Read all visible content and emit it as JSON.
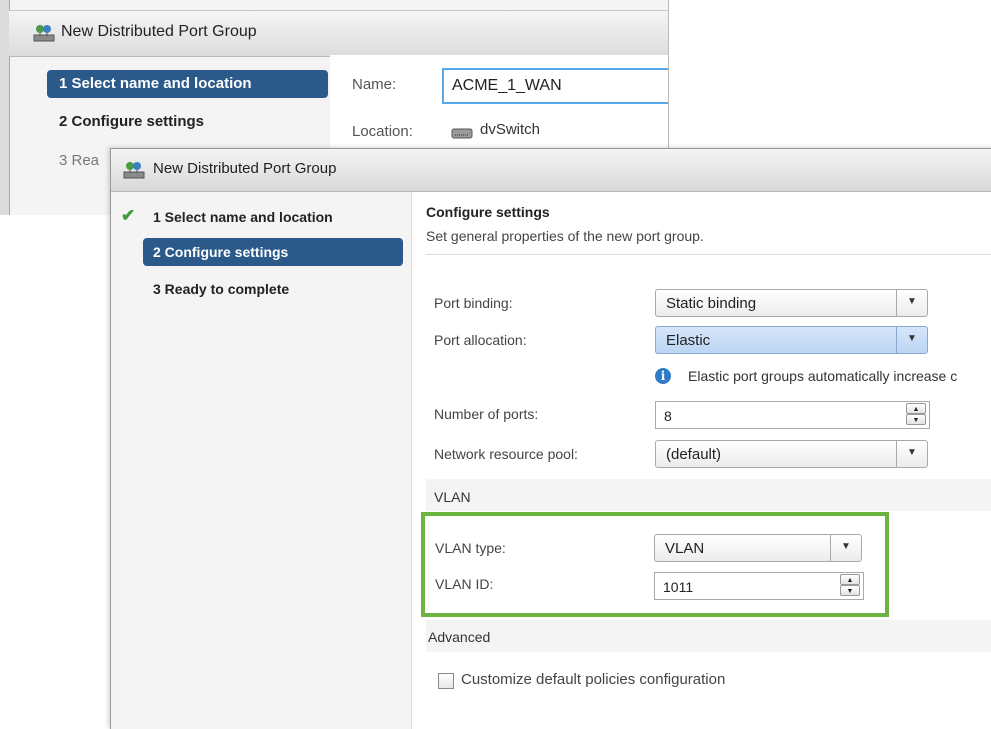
{
  "back_dialog": {
    "title": "New Distributed Port Group",
    "steps": [
      {
        "label": "1  Select name and location"
      },
      {
        "label": "2  Configure settings"
      },
      {
        "label": "3  Rea"
      }
    ],
    "name_label": "Name:",
    "name_value": "ACME_1_WAN",
    "location_label": "Location:",
    "location_value": "dvSwitch",
    "location_icon": "switch-icon"
  },
  "front_dialog": {
    "title": "New Distributed Port Group",
    "steps": [
      {
        "label": "1  Select name and location",
        "state": "completed"
      },
      {
        "label": "2  Configure settings",
        "state": "active"
      },
      {
        "label": "3  Ready to complete",
        "state": "pending"
      }
    ],
    "header": {
      "title": "Configure settings",
      "subtitle": "Set general properties of the new port group."
    },
    "fields": {
      "port_binding": {
        "label": "Port binding:",
        "value": "Static binding"
      },
      "port_allocation": {
        "label": "Port allocation:",
        "value": "Elastic"
      },
      "info_text": "Elastic port groups automatically increase c",
      "number_of_ports": {
        "label": "Number of ports:",
        "value": "8"
      },
      "network_resource_pool": {
        "label": "Network resource pool:",
        "value": "(default)"
      }
    },
    "vlan": {
      "section_title": "VLAN",
      "type_label": "VLAN type:",
      "type_value": "VLAN",
      "id_label": "VLAN ID:",
      "id_value": "1011",
      "highlight_color": "#6db33f"
    },
    "advanced": {
      "section_title": "Advanced",
      "customize_label": "Customize default policies configuration",
      "customize_checked": false
    }
  },
  "colors": {
    "selected_step": "#2b5a8a",
    "check": "#3c9c3c",
    "info": "#2f7bc9"
  }
}
